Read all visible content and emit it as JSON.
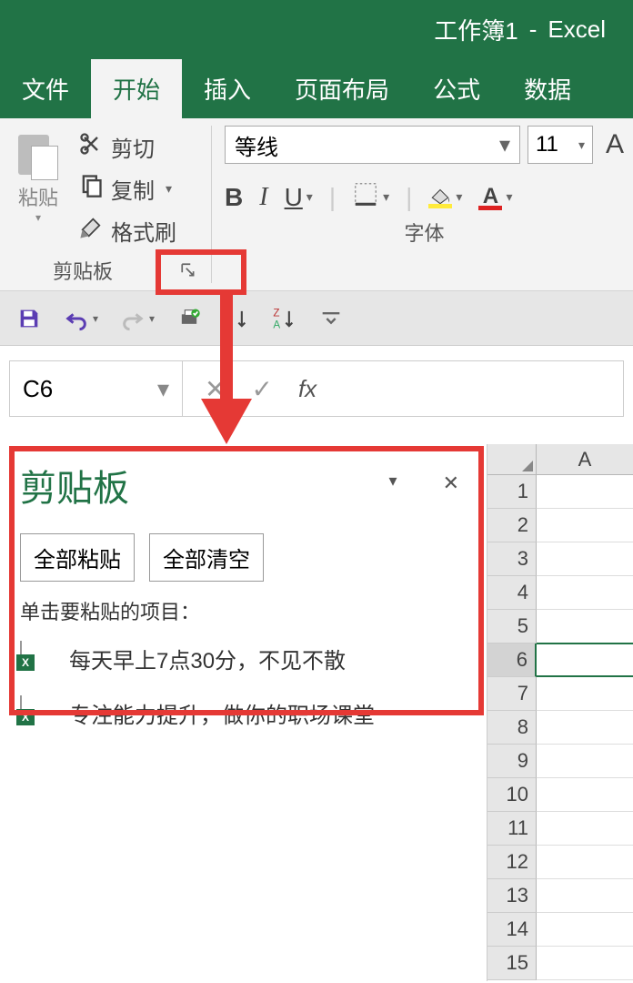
{
  "title": {
    "workbook": "工作簿1",
    "dash": "-",
    "app": "Excel"
  },
  "tabs": {
    "file": "文件",
    "home": "开始",
    "insert": "插入",
    "layout": "页面布局",
    "formulas": "公式",
    "data": "数据"
  },
  "clipboard_group": {
    "paste": "粘贴",
    "cut": "剪切",
    "copy": "复制",
    "format_painter": "格式刷",
    "label": "剪贴板"
  },
  "font_group": {
    "font_name": "等线",
    "font_size": "11",
    "label": "字体"
  },
  "namebox": "C6",
  "fx": "fx",
  "clip_pane": {
    "title": "剪贴板",
    "paste_all": "全部粘贴",
    "clear_all": "全部清空",
    "instruction": "单击要粘贴的项目：",
    "items": [
      "每天早上7点30分，不见不散",
      "专注能力提升，做你的职场课堂"
    ]
  },
  "grid": {
    "col": "A",
    "row_count": 15,
    "selected_row": 6
  },
  "icons": {
    "dd": "▾",
    "close": "✕",
    "cancel": "✕",
    "check": "✓",
    "bold": "B",
    "italic": "I",
    "underline": "U",
    "letterA_big": "A",
    "letterA_color": "A"
  }
}
